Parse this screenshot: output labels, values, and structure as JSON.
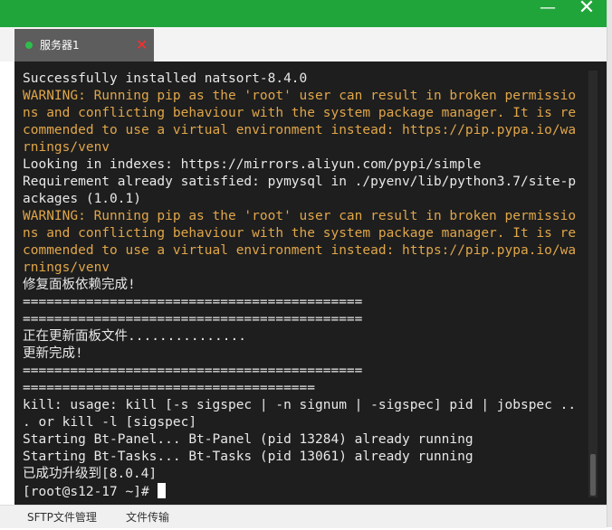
{
  "window": {
    "minimize_glyph": "—",
    "close_glyph": "✕"
  },
  "tabs": [
    {
      "label": "服务器1",
      "status": "connected",
      "status_color": "#2fbd4b",
      "close_glyph": "✕",
      "close_color": "#ff2d2d"
    }
  ],
  "terminal": {
    "lines": [
      {
        "text": "Successfully installed natsort-8.4.0",
        "type": "normal"
      },
      {
        "text": "WARNING: Running pip as the 'root' user can result in broken permissio",
        "type": "warn"
      },
      {
        "text": "ns and conflicting behaviour with the system package manager. It is re",
        "type": "warn"
      },
      {
        "text": "commended to use a virtual environment instead: https://pip.pypa.io/wa",
        "type": "warn"
      },
      {
        "text": "rnings/venv",
        "type": "warn"
      },
      {
        "text": "Looking in indexes: https://mirrors.aliyun.com/pypi/simple",
        "type": "normal"
      },
      {
        "text": "Requirement already satisfied: pymysql in ./pyenv/lib/python3.7/site-p",
        "type": "normal"
      },
      {
        "text": "ackages (1.0.1)",
        "type": "normal"
      },
      {
        "text": "WARNING: Running pip as the 'root' user can result in broken permissio",
        "type": "warn"
      },
      {
        "text": "ns and conflicting behaviour with the system package manager. It is re",
        "type": "warn"
      },
      {
        "text": "commended to use a virtual environment instead: https://pip.pypa.io/wa",
        "type": "warn"
      },
      {
        "text": "rnings/venv",
        "type": "warn"
      },
      {
        "text": "修复面板依赖完成!",
        "type": "normal"
      },
      {
        "text": "===========================================",
        "type": "normal"
      },
      {
        "text": "===========================================",
        "type": "normal"
      },
      {
        "text": "正在更新面板文件...............",
        "type": "normal"
      },
      {
        "text": "更新完成!",
        "type": "normal"
      },
      {
        "text": "===========================================",
        "type": "normal"
      },
      {
        "text": "=====================================",
        "type": "normal"
      },
      {
        "text": "kill: usage: kill [-s sigspec | -n signum | -sigspec] pid | jobspec ..",
        "type": "normal"
      },
      {
        "text": ". or kill -l [sigspec]",
        "type": "normal"
      },
      {
        "text": "Starting Bt-Panel... Bt-Panel (pid 13284) already running",
        "type": "normal"
      },
      {
        "text": "Starting Bt-Tasks... Bt-Tasks (pid 13061) already running",
        "type": "normal"
      },
      {
        "text": "已成功升级到[8.0.4]",
        "type": "normal"
      }
    ],
    "prompt": "[root@s12-17 ~]# ",
    "text_color": "#e8e8e8",
    "warning_color": "#e0a64a",
    "background": "#1e1e1e"
  },
  "bottom_bar": {
    "sftp_label": "SFTP文件管理",
    "transfer_label": "文件传输"
  },
  "colors": {
    "titlebar": "#20a53a",
    "tab_active": "#5d5d5d"
  }
}
